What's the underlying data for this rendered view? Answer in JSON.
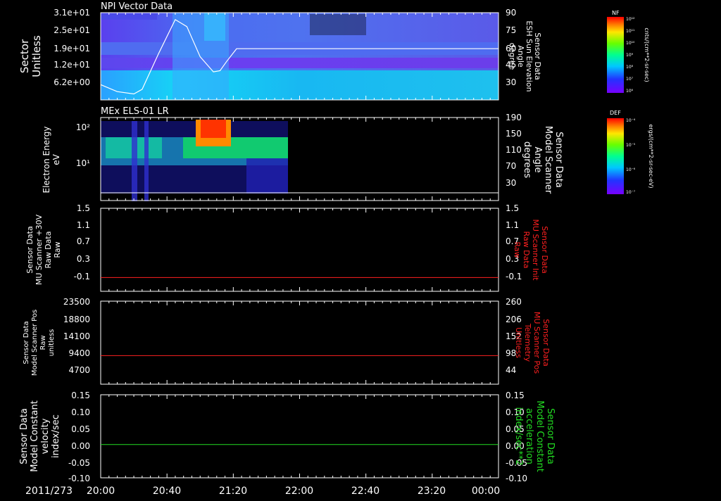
{
  "colors": {
    "background": "#000000",
    "axis": "#ffffff",
    "red_trace": "#ff2020",
    "green_trace": "#22dd22"
  },
  "time_axis": {
    "date_label": "2011/273",
    "ticks": [
      "20:00",
      "20:40",
      "21:20",
      "22:00",
      "22:40",
      "23:20",
      "00:00"
    ]
  },
  "chart_data": [
    {
      "type": "heatmap",
      "title": "NPI Vector Data",
      "ylabel_lines": [
        "Sector",
        "Unitless"
      ],
      "y_ticks": [
        "3.1e+01",
        "2.5e+01",
        "1.9e+01",
        "1.2e+01",
        "6.2e+00"
      ],
      "right_ylabel_lines": [
        "Sensor Data",
        "ESH Sun Elevation",
        "Angle",
        "degree"
      ],
      "right_ticks": [
        "90",
        "75",
        "60",
        "45",
        "30"
      ],
      "line_series": {
        "name": "ESH Sun Elevation Angle",
        "x_minutes": [
          0,
          10,
          20,
          25,
          35,
          45,
          52,
          60,
          68,
          72,
          76,
          82,
          240
        ],
        "y_degrees": [
          28,
          22,
          20,
          24,
          55,
          84,
          78,
          52,
          39,
          40,
          48,
          59,
          59
        ]
      },
      "colorbar": {
        "label": "NF",
        "unit": "cnts/(cm**2-sr-sec)",
        "ticks": [
          "10¹²",
          "10¹¹",
          "10¹⁰",
          "10⁹",
          "10⁸",
          "10⁷",
          "10⁶"
        ]
      }
    },
    {
      "type": "heatmap",
      "title": "MEx ELS-01 LR",
      "ylabel_lines": [
        "Electron Energy",
        "eV"
      ],
      "y_ticks": [
        "10²",
        "10¹"
      ],
      "right_ylabel_lines": [
        "Sensor Data",
        "Model Scanner",
        "Angle",
        "degrees"
      ],
      "right_ticks": [
        "190",
        "150",
        "110",
        "70",
        "30"
      ],
      "colorbar": {
        "label": "DEF",
        "unit": "ergs/(cm**2-sr-sec-eV)",
        "ticks": [
          "10⁻⁴",
          "10⁻⁵",
          "10⁻⁶",
          "10⁻⁷"
        ]
      }
    },
    {
      "type": "line",
      "ylabel_lines": [
        "Sensor Data",
        "MU Scanner +30V",
        "Raw Data",
        "Raw"
      ],
      "y_ticks": [
        "1.5",
        "1.1",
        "0.7",
        "0.3",
        "-0.1"
      ],
      "right_ylabel_lines": [
        "Sensor Data",
        "MU Scanner Init",
        "Raw Data",
        "Raw"
      ],
      "right_ticks": [
        "1.5",
        "1.1",
        "0.7",
        "0.3",
        "-0.1"
      ],
      "ylim": [
        -0.3,
        1.5
      ],
      "series": [
        {
          "x": [
            0,
            240
          ],
          "values": [
            0.0,
            0.0
          ]
        }
      ]
    },
    {
      "type": "line",
      "ylabel_lines": [
        "Sensor Data",
        "Model Scanner Pos",
        "Raw",
        "unitless"
      ],
      "y_ticks": [
        "23500",
        "18800",
        "14100",
        "9400",
        "4700"
      ],
      "right_ylabel_lines": [
        "Sensor Data",
        "MU Scanner Pos",
        "Telemetry",
        "Unitless"
      ],
      "right_ticks": [
        "260",
        "206",
        "152",
        "98",
        "44"
      ],
      "ylim": [
        0,
        23500
      ],
      "series": [
        {
          "x": [
            0,
            240
          ],
          "values": [
            8100,
            8100
          ]
        }
      ]
    },
    {
      "type": "line",
      "ylabel_lines": [
        "Sensor Data",
        "Model Constant",
        "velocity",
        "index/sec"
      ],
      "y_ticks": [
        "0.15",
        "0.10",
        "0.05",
        "0.00",
        "-0.05",
        "-0.10"
      ],
      "right_ylabel_lines": [
        "Sensor Data",
        "Model Constant",
        "acceleration",
        "index/sec**2"
      ],
      "right_ticks": [
        "0.15",
        "0.10",
        "0.05",
        "0.00",
        "-0.05",
        "-0.10"
      ],
      "ylim": [
        -0.1,
        0.15
      ],
      "series": [
        {
          "x": [
            0,
            240
          ],
          "values": [
            0.0,
            0.0
          ]
        }
      ]
    }
  ]
}
